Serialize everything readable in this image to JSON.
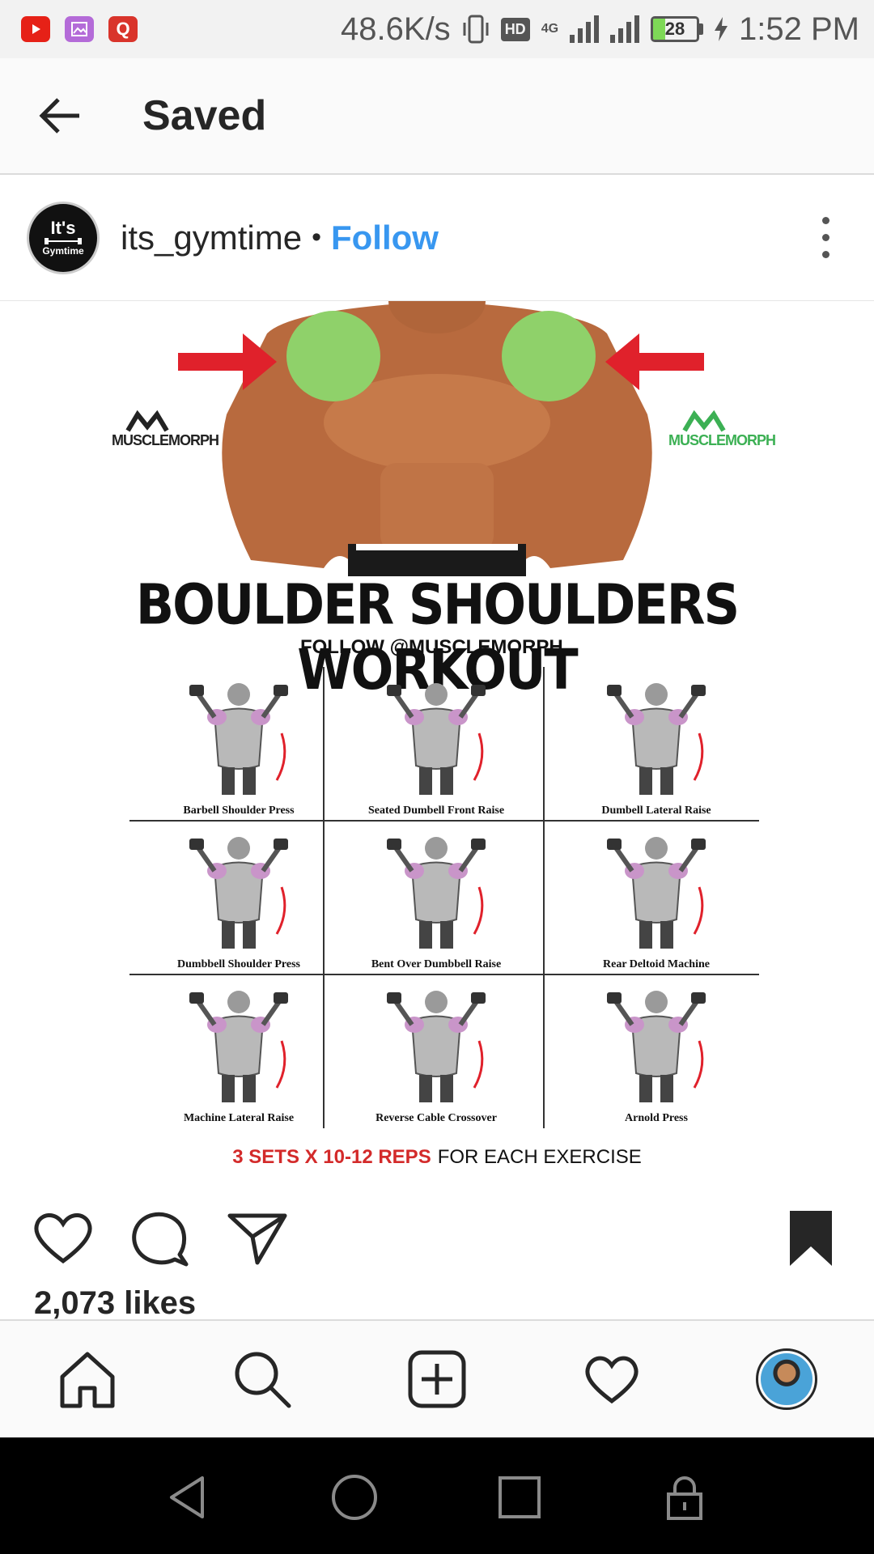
{
  "status_bar": {
    "speed": "48.6K/s",
    "hd": "HD",
    "network": "4G",
    "battery": "28",
    "battery_level": 0.28,
    "time": "1:52 PM",
    "notification_icons": [
      "youtube-icon",
      "gallery-icon",
      "q-app-icon"
    ]
  },
  "header": {
    "title": "Saved"
  },
  "post": {
    "avatar_text_1": "It's",
    "avatar_text_2": "Gymtime",
    "username": "its_gymtime",
    "separator": "•",
    "follow_label": "Follow",
    "image": {
      "brand": "MUSCLEMORPH",
      "title": "BOULDER SHOULDERS WORKOUT",
      "follow_line": "FOLLOW @MUSCLEMORPH_",
      "exercises": [
        "Barbell Shoulder Press",
        "Seated Dumbell Front Raise",
        "Dumbell Lateral Raise",
        "Dumbbell Shoulder Press",
        "Bent Over Dumbbell Raise",
        "Rear Deltoid Machine",
        "Machine Lateral Raise",
        "Reverse Cable Crossover",
        "Arnold Press"
      ],
      "footer_red": "3 SETS X 10-12 REPS",
      "footer_black": "FOR EACH EXERCISE",
      "accent_red": "#e0212b",
      "accent_green": "#8fd16a"
    },
    "likes": "2,073 likes",
    "saved": true
  },
  "bottom_nav": {
    "items": [
      "home-icon",
      "search-icon",
      "new-post-icon",
      "activity-icon",
      "profile-avatar"
    ]
  },
  "system_nav": {
    "items": [
      "back-icon",
      "home-circle-icon",
      "recents-icon",
      "lock-icon"
    ]
  },
  "colors": {
    "link_blue": "#3897f0",
    "text": "#262626"
  }
}
